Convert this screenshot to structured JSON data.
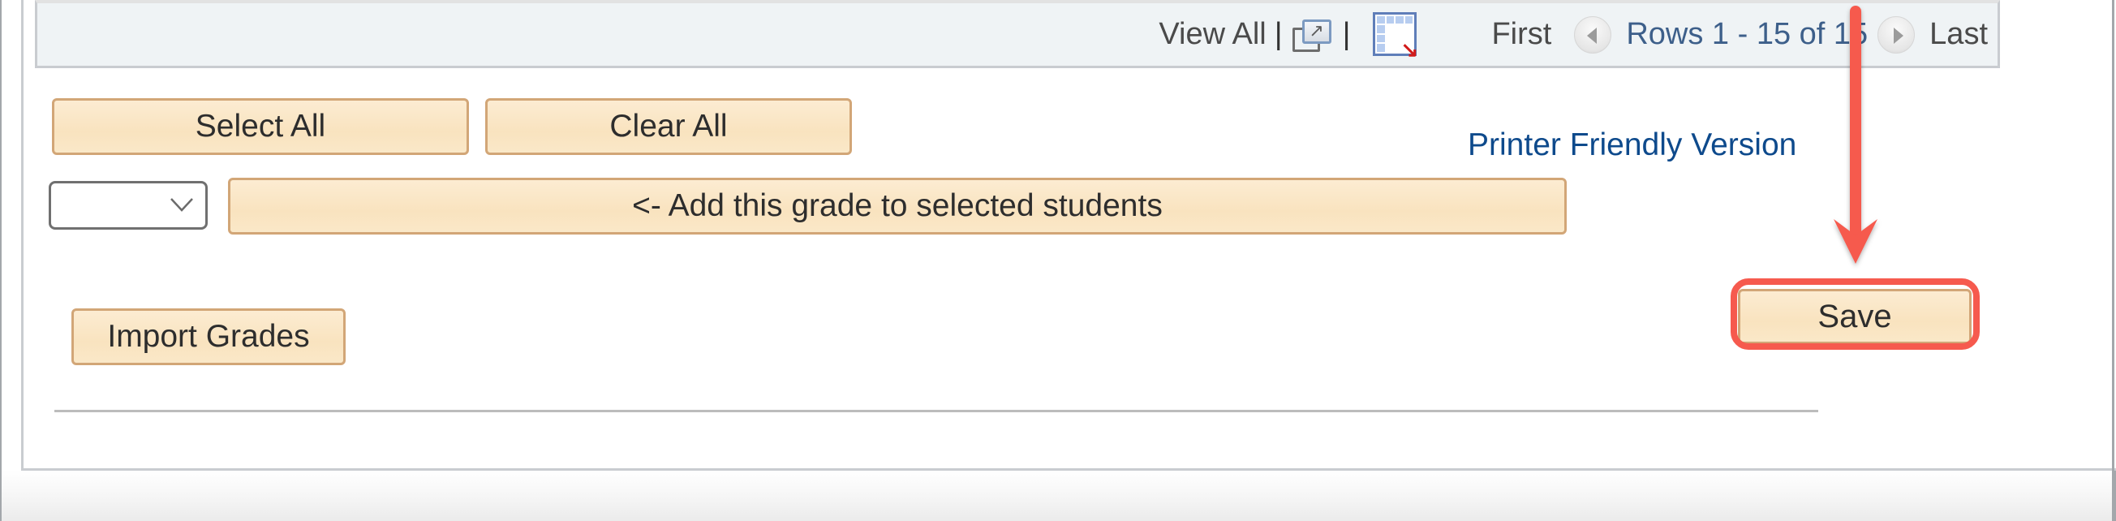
{
  "grid_nav": {
    "view_all_label": "View All",
    "separator": "|",
    "zoom_icon": "zoom-expand-icon",
    "download_icon": "download-to-excel-icon",
    "first_label": "First",
    "prev_icon": "prev-arrow-icon",
    "rows_label": "Rows 1 - 15 of 15",
    "next_icon": "next-arrow-icon",
    "last_label": "Last"
  },
  "actions": {
    "select_all_label": "Select All",
    "clear_all_label": "Clear All",
    "grade_select": {
      "selected_value": "",
      "chevron_icon": "chevron-down-icon"
    },
    "add_grade_label": "<- Add this grade to selected students",
    "printer_friendly_label": "Printer Friendly Version",
    "import_grades_label": "Import Grades",
    "save_label": "Save"
  },
  "annotation": {
    "color": "#f65a4e",
    "arrow_icon": "down-arrow-annotation",
    "highlight_target": "Save"
  },
  "colors": {
    "button_fill": "#f9e3bf",
    "button_border": "#d2a677",
    "link_blue": "#0e4a8c",
    "rows_blue": "#3d5f8a",
    "nav_bg": "#eff3f5"
  }
}
